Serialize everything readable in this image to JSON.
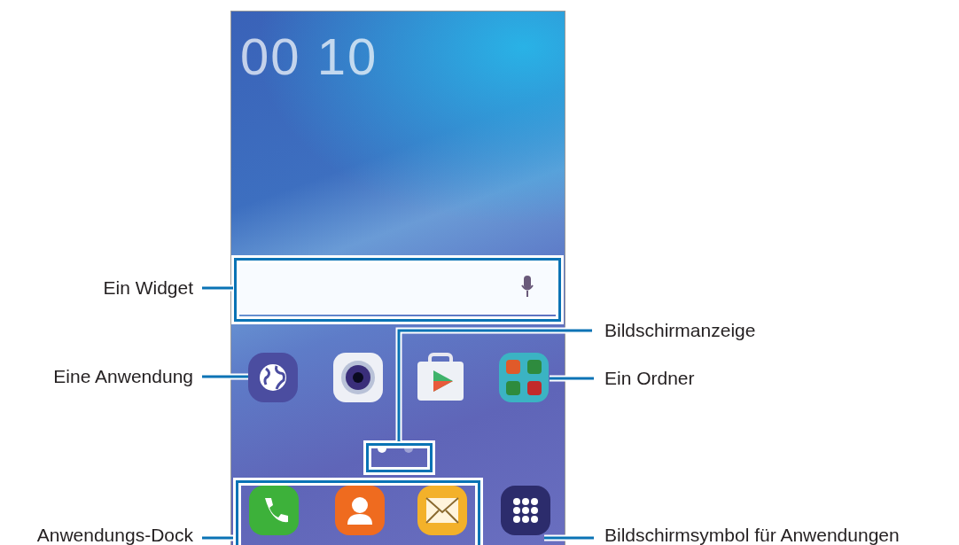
{
  "phone": {
    "clock": "00 10",
    "page_indicator": [
      {
        "selected": true
      },
      {
        "selected": false
      }
    ]
  },
  "callouts": [
    {
      "text": "Ein Widget"
    },
    {
      "text": "Eine Anwendung"
    },
    {
      "text": "Bildschirmanzeige"
    },
    {
      "text": "Ein Ordner"
    },
    {
      "text": "Anwendungs-Dock"
    },
    {
      "text": "Bildschirmsymbol für Anwendungen"
    }
  ]
}
